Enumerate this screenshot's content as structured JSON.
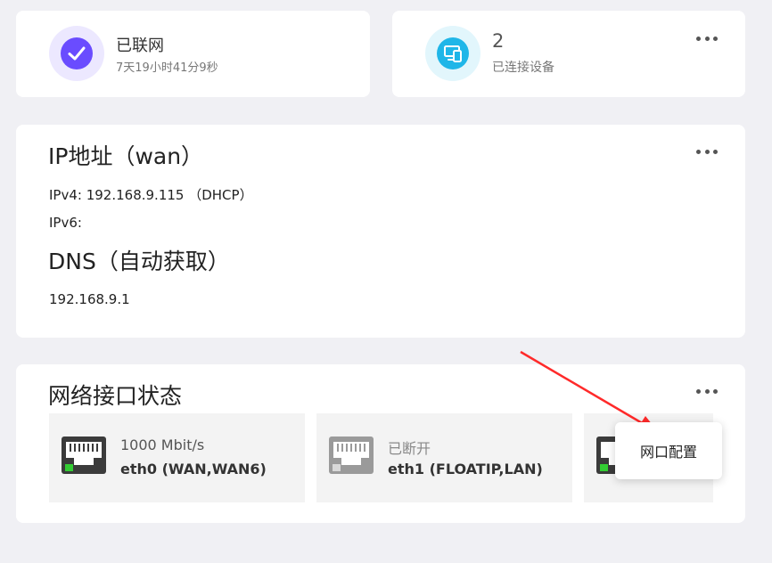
{
  "status": {
    "title": "已联网",
    "uptime": "7天19小时41分9秒"
  },
  "devices": {
    "count": "2",
    "label": "已连接设备"
  },
  "ip": {
    "title": "IP地址（wan）",
    "ipv4": "IPv4: 192.168.9.115 （DHCP）",
    "ipv6": "IPv6:",
    "dns_title": "DNS（自动获取）",
    "dns": "192.168.9.1"
  },
  "ports": {
    "title": "网络接口状态",
    "items": [
      {
        "speed": "1000 Mbit/s",
        "name": "eth0 (WAN,WAN6)",
        "connected": true
      },
      {
        "speed": "已断开",
        "name": "eth1 (FLOATIP,LAN)",
        "connected": false
      },
      {
        "speed": "",
        "name": "",
        "connected": true
      }
    ]
  },
  "popover": {
    "label": "网口配置"
  },
  "colors": {
    "accent_purple": "#6a4cff",
    "accent_cyan": "#1fb6e8",
    "link_green": "#33cc33",
    "annotation_red": "#ff2a2a"
  }
}
